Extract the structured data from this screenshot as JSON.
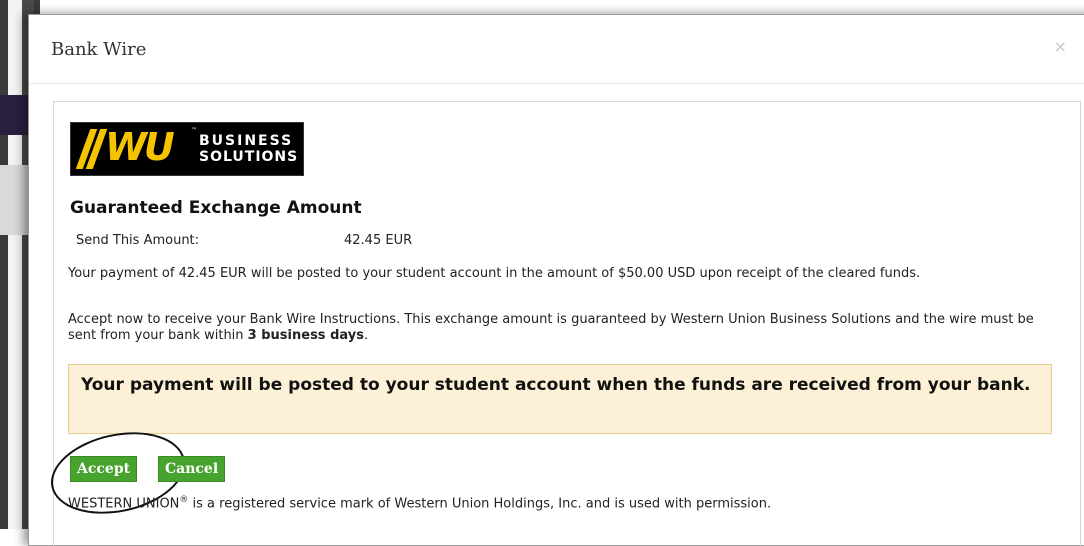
{
  "modal": {
    "title": "Bank Wire",
    "close_label": "×"
  },
  "logo": {
    "mark": "WU",
    "tm": "™",
    "line1": "BUSINESS",
    "line2": "SOLUTIONS",
    "brand_color": "#f5c400"
  },
  "exchange": {
    "heading": "Guaranteed Exchange Amount",
    "send_label": "Send This Amount:",
    "send_value": "42.45 EUR"
  },
  "text": {
    "para1": "Your payment of 42.45 EUR will be posted to your student account in the amount of $50.00 USD upon receipt of the cleared funds.",
    "para2_a": "Accept now to receive your Bank Wire Instructions. This exchange amount is guaranteed by Western Union Business Solutions and the wire must be sent from your bank within ",
    "para2_b": "3 business days",
    "para2_c": ".",
    "notice": "Your payment will be posted to your student account when the funds are received from your bank.",
    "footer_a": "WESTERN UNION",
    "footer_reg": "®",
    "footer_b": " is a registered service mark of Western Union Holdings, Inc. and is used with permission."
  },
  "buttons": {
    "accept": "Accept",
    "cancel": "Cancel",
    "color": "#46a32d"
  }
}
